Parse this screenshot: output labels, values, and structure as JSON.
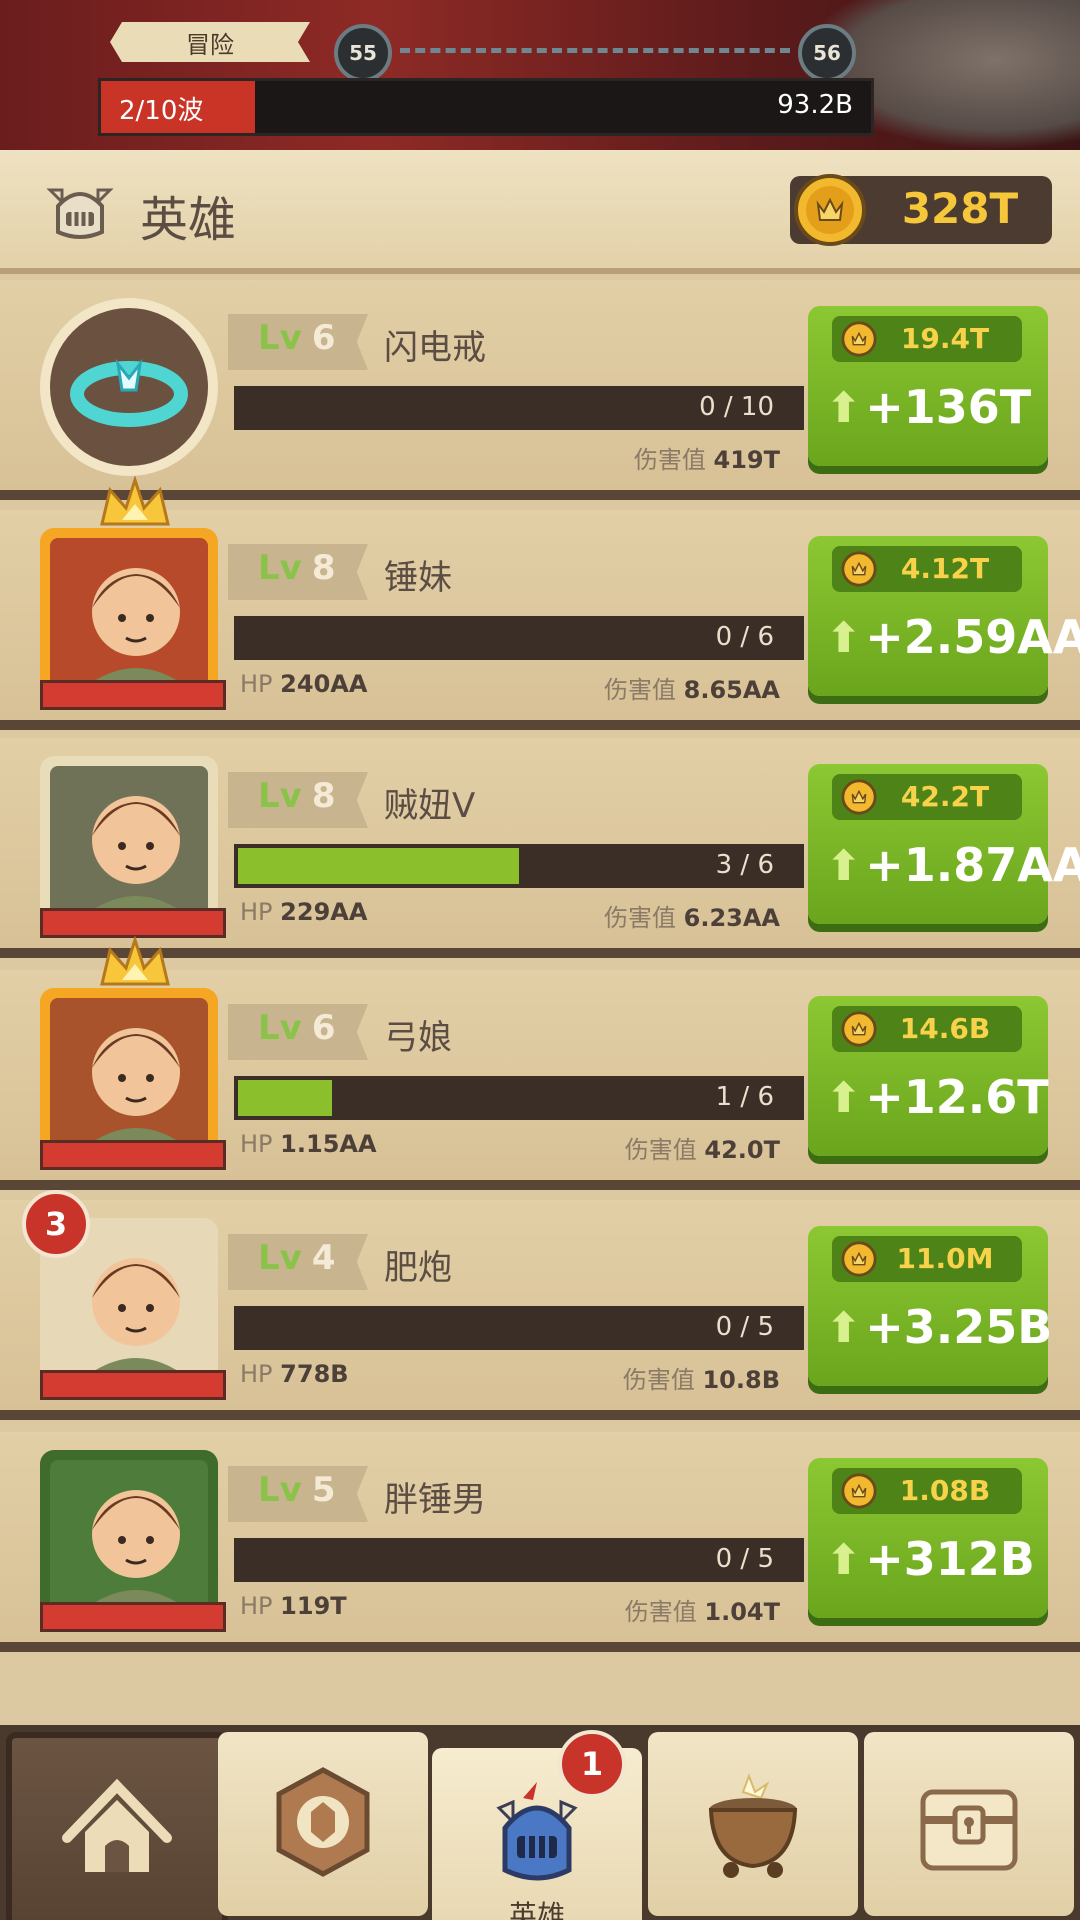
{
  "battle": {
    "stage_label": "冒险",
    "current_stage": "55",
    "next_stage": "56",
    "wave_label": "2/10波",
    "wave_progress": 0.2,
    "boss_hp": "93.2B"
  },
  "header": {
    "title": "英雄",
    "gold": "328T"
  },
  "items": [
    {
      "kind": "artifact",
      "lv_prefix": "Lv",
      "level": "6",
      "name": "闪电戒",
      "progress_text": "0 / 10",
      "progress": 0.0,
      "hp_label": "",
      "hp": "",
      "dmg_label": "伤害值",
      "dmg": "419T",
      "cost": "19.4T",
      "gain": "+136T"
    },
    {
      "kind": "hero",
      "lv_prefix": "Lv",
      "level": "8",
      "name": "锤妹",
      "progress_text": "0 / 6",
      "progress": 0.0,
      "hp_label": "HP",
      "hp": "240AA",
      "dmg_label": "伤害值",
      "dmg": "8.65AA",
      "cost": "4.12T",
      "gain": "+2.59AA",
      "crown": true
    },
    {
      "kind": "hero",
      "lv_prefix": "Lv",
      "level": "8",
      "name": "贼妞V",
      "progress_text": "3 / 6",
      "progress": 0.5,
      "hp_label": "HP",
      "hp": "229AA",
      "dmg_label": "伤害值",
      "dmg": "6.23AA",
      "cost": "42.2T",
      "gain": "+1.87AA"
    },
    {
      "kind": "hero",
      "lv_prefix": "Lv",
      "level": "6",
      "name": "弓娘",
      "progress_text": "1 / 6",
      "progress": 0.1667,
      "hp_label": "HP",
      "hp": "1.15AA",
      "dmg_label": "伤害值",
      "dmg": "42.0T",
      "cost": "14.6B",
      "gain": "+12.6T",
      "crown": true
    },
    {
      "kind": "hero",
      "lv_prefix": "Lv",
      "level": "4",
      "name": "肥炮",
      "progress_text": "0 / 5",
      "progress": 0.0,
      "hp_label": "HP",
      "hp": "778B",
      "dmg_label": "伤害值",
      "dmg": "10.8B",
      "cost": "11.0M",
      "gain": "+3.25B",
      "badge": "3"
    },
    {
      "kind": "hero",
      "lv_prefix": "Lv",
      "level": "5",
      "name": "胖锤男",
      "progress_text": "0 / 5",
      "progress": 0.0,
      "hp_label": "HP",
      "hp": "119T",
      "dmg_label": "伤害值",
      "dmg": "1.04T",
      "cost": "1.08B",
      "gain": "+312B"
    }
  ],
  "nav": {
    "tabs": [
      {
        "icon": "camp-icon",
        "label": ""
      },
      {
        "icon": "skill-icon",
        "label": ""
      },
      {
        "icon": "helmet-icon",
        "label": "英雄",
        "badge": "1"
      },
      {
        "icon": "cauldron-icon",
        "label": ""
      },
      {
        "icon": "chest-icon",
        "label": ""
      }
    ]
  },
  "colors": {
    "accent_green": "#8cc832",
    "gold": "#f6c73a",
    "hp_red": "#d43c31"
  }
}
